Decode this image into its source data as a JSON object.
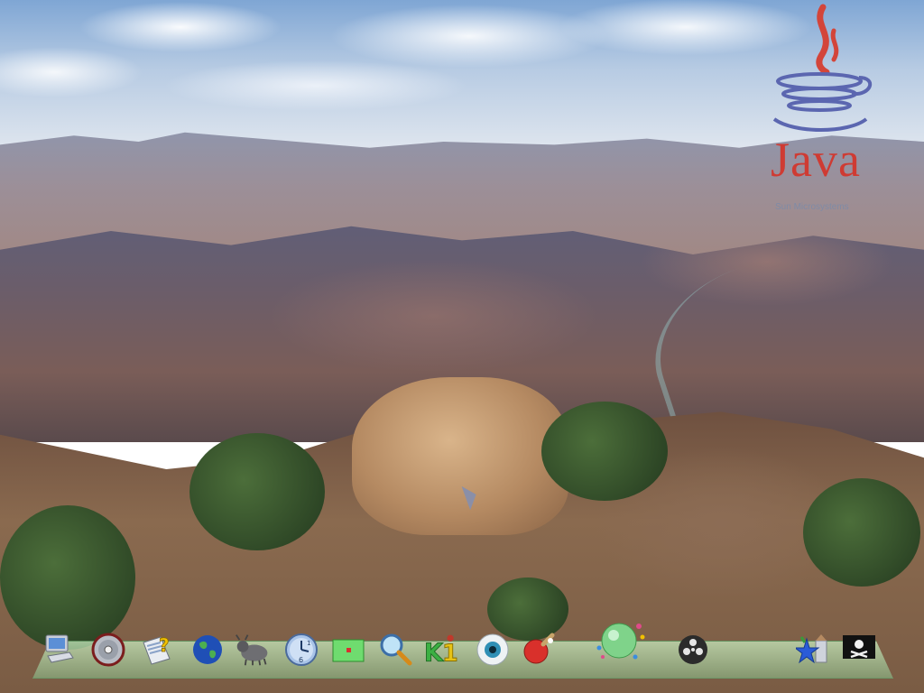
{
  "desktop": {
    "wallpaper": "grand-canyon-landscape"
  },
  "logo": {
    "word": "Java",
    "company": "Sun Microsystems",
    "color": "#cf3b33"
  },
  "dock": {
    "items": [
      {
        "name": "computer-icon"
      },
      {
        "name": "cd-disc-icon"
      },
      {
        "name": "help-document-icon"
      },
      {
        "name": "globe-icon"
      },
      {
        "name": "gnu-icon"
      },
      {
        "name": "clock-icon"
      },
      {
        "name": "green-box-icon"
      },
      {
        "name": "magnifier-icon"
      },
      {
        "name": "k1-icon"
      },
      {
        "name": "eye-icon"
      },
      {
        "name": "ping-pong-paddle-icon"
      },
      {
        "name": "green-sphere-icon"
      },
      {
        "name": "film-reel-icon"
      },
      {
        "name": "star-castle-icon"
      },
      {
        "name": "pirate-flag-icon"
      }
    ]
  }
}
